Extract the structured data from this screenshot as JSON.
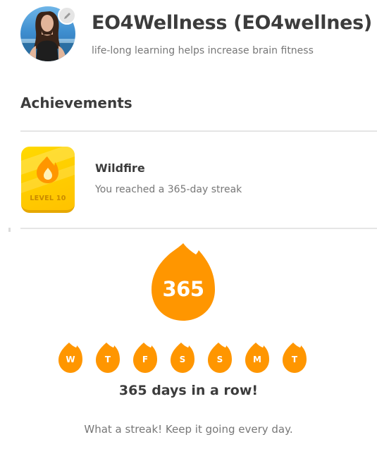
{
  "profile": {
    "display_name": "EO4Wellness (EO4wellnes)",
    "tagline": "life-long learning helps increase brain fitness",
    "avatar_icon": "user-photo",
    "edit_icon": "pencil-icon"
  },
  "achievements": {
    "title": "Achievements",
    "items": [
      {
        "title": "Wildfire",
        "description": "You reached a 365-day streak",
        "level_label": "LEVEL 10",
        "icon": "flame-icon"
      }
    ]
  },
  "streak": {
    "count": "365",
    "days": [
      "W",
      "T",
      "F",
      "S",
      "S",
      "M",
      "T"
    ],
    "headline": "365 days in a row!",
    "message": "What a streak! Keep it going every day."
  },
  "colors": {
    "flame_orange": "#ff9600",
    "badge_gold": "#ffc800",
    "text_dark": "#3c3c3c",
    "text_muted": "#777777",
    "divider": "#e5e5e5"
  }
}
